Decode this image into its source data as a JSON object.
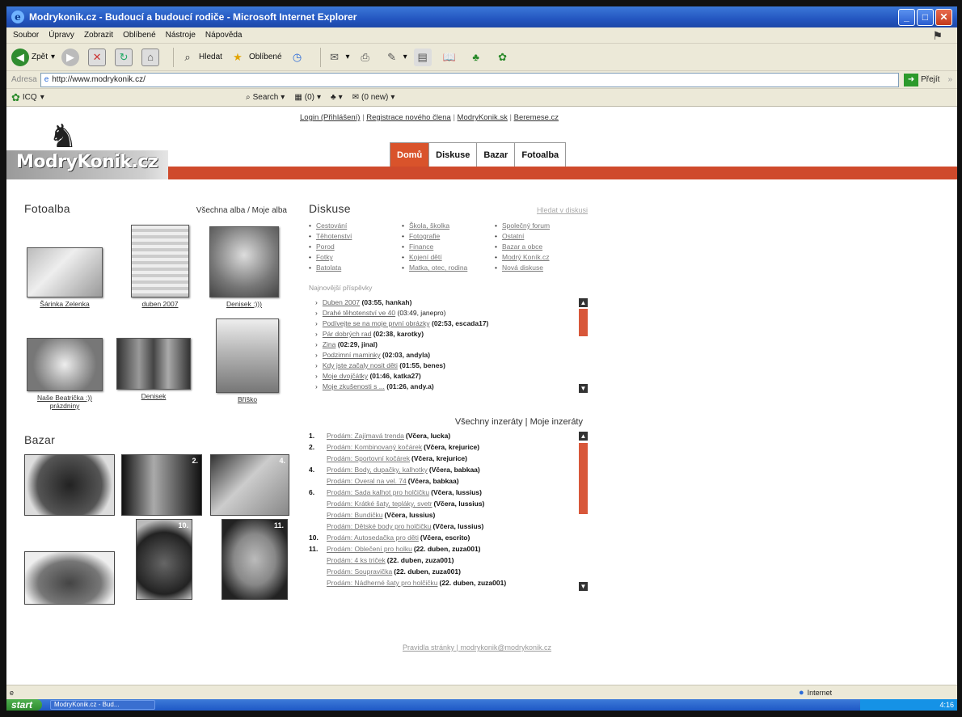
{
  "window": {
    "title": "Modrykonik.cz - Budoucí a budoucí rodiče - Microsoft Internet Explorer"
  },
  "menu": [
    "Soubor",
    "Úpravy",
    "Zobrazit",
    "Oblíbené",
    "Nástroje",
    "Nápověda"
  ],
  "toolbar": {
    "back": "Zpět",
    "search": "Hledat",
    "favorites": "Oblíbené"
  },
  "address": {
    "label": "Adresa",
    "url": "http://www.modrykonik.cz/",
    "go": "Přejít"
  },
  "icq": {
    "label": "ICQ",
    "search": "Search",
    "count1": "(0)",
    "count2": "(0 new)"
  },
  "site": {
    "logo_text": "ModryKonik.cz",
    "toplinks": {
      "login": "Login (Přihlášení)",
      "register": "Registrace nového člena",
      "sk": "ModryKonik.sk",
      "sister": "Beremese.cz"
    },
    "nav": [
      "Domů",
      "Diskuse",
      "Bazar",
      "Fotoalba"
    ]
  },
  "fotoalba": {
    "title": "Fotoalba",
    "links": "Všechna alba / Moje alba",
    "albums": [
      {
        "caption": "Šárinka Zelenka"
      },
      {
        "caption": "duben 2007"
      },
      {
        "caption": "Denisek :)))"
      },
      {
        "caption": "Naše Beatrička :)) prázdniny"
      },
      {
        "caption": "Denisek"
      },
      {
        "caption": "Bříško"
      }
    ]
  },
  "diskuse": {
    "title": "Diskuse",
    "search_link": "Hledat v diskusi",
    "categories": [
      [
        "Cestování",
        "Těhotenství",
        "Porod",
        "Fotky",
        "Batolata"
      ],
      [
        "Škola, školka",
        "Fotografie",
        "Finance",
        "Kojení dětí",
        "Matka, otec, rodina"
      ],
      [
        "Společný forum",
        "Ostatní",
        "Bazar a obce",
        "Modrý Koník.cz",
        "Nová diskuse"
      ]
    ],
    "newest_label": "Najnovější příspěvky",
    "posts": [
      {
        "link": "Duben 2007",
        "meta": "(03:55, hankah)"
      },
      {
        "link": "Drahé těhotenství ve 40",
        "meta": "(03:49, janepro)"
      },
      {
        "link": "Podívejte se na moje první obrázky",
        "meta": "(02:53, escada17)"
      },
      {
        "link": "Pár dobrých rad",
        "meta": "(02:38, karotky)"
      },
      {
        "link": "Zina",
        "meta": "(02:29, jinal)"
      },
      {
        "link": "Podzimní maminky",
        "meta": "(02:03, andyla)"
      },
      {
        "link": "Kdy jste začaly nosit děti",
        "meta": "(01:55, benes)"
      },
      {
        "link": "Moje dvojčátky",
        "meta": "(01:46, katka27)"
      },
      {
        "link": "Moje zkušenosti s ...",
        "meta": "(01:26, andy.a)"
      }
    ]
  },
  "inzeraty": {
    "links": "Všechny inzeráty | Moje inzeráty",
    "items": [
      {
        "num": "1.",
        "link": "Prodám: Zajímavá trenda",
        "meta": "(Včera, lucka)"
      },
      {
        "num": "2.",
        "link": "Prodám: Kombinovaný kočárek",
        "meta": "(Včera, krejurice)"
      },
      {
        "num": "",
        "link": "Prodám: Sportovní kočárek",
        "meta": "(Včera, krejurice)"
      },
      {
        "num": "4.",
        "link": "Prodám: Body, dupačky, kalhotky",
        "meta": "(Včera, babkaa)"
      },
      {
        "num": "",
        "link": "Prodám: Overal na vel. 74",
        "meta": "(Včera, babkaa)"
      },
      {
        "num": "6.",
        "link": "Prodám: Sada kalhot pro holčičku",
        "meta": "(Včera, lussius)"
      },
      {
        "num": "",
        "link": "Prodám: Krátké šaty, tepláky, svetr",
        "meta": "(Včera, lussius)"
      },
      {
        "num": "",
        "link": "Prodám: Bundičku",
        "meta": "(Včera, lussius)"
      },
      {
        "num": "",
        "link": "Prodám: Dětské body pro holčičku",
        "meta": "(Včera, lussius)"
      },
      {
        "num": "10.",
        "link": "Prodám: Autosedačka pro děti",
        "meta": "(Včera, escrito)"
      },
      {
        "num": "11.",
        "link": "Prodám: Oblečení pro holku",
        "meta": "(22. duben, zuza001)"
      },
      {
        "num": "",
        "link": "Prodám: 4 ks triček",
        "meta": "(22. duben, zuza001)"
      },
      {
        "num": "",
        "link": "Prodám: Soupravička",
        "meta": "(22. duben, zuza001)"
      },
      {
        "num": "",
        "link": "Prodám: Nádherné šaty pro holčičku",
        "meta": "(22. duben, zuza001)"
      }
    ]
  },
  "bazar": {
    "title": "Bazar",
    "badges": [
      "2.",
      "4.",
      "10.",
      "11."
    ]
  },
  "footer": {
    "links": "Pravidla stránky | modrykonik@modrykonik.cz"
  },
  "status": {
    "zone": "Internet"
  },
  "taskbar": {
    "start": "start",
    "task": "ModryKonik.cz - Bud...",
    "clock": "4:16"
  },
  "colors": {
    "accent_red": "#cf4a2c",
    "xp_blue": "#2456c0"
  }
}
